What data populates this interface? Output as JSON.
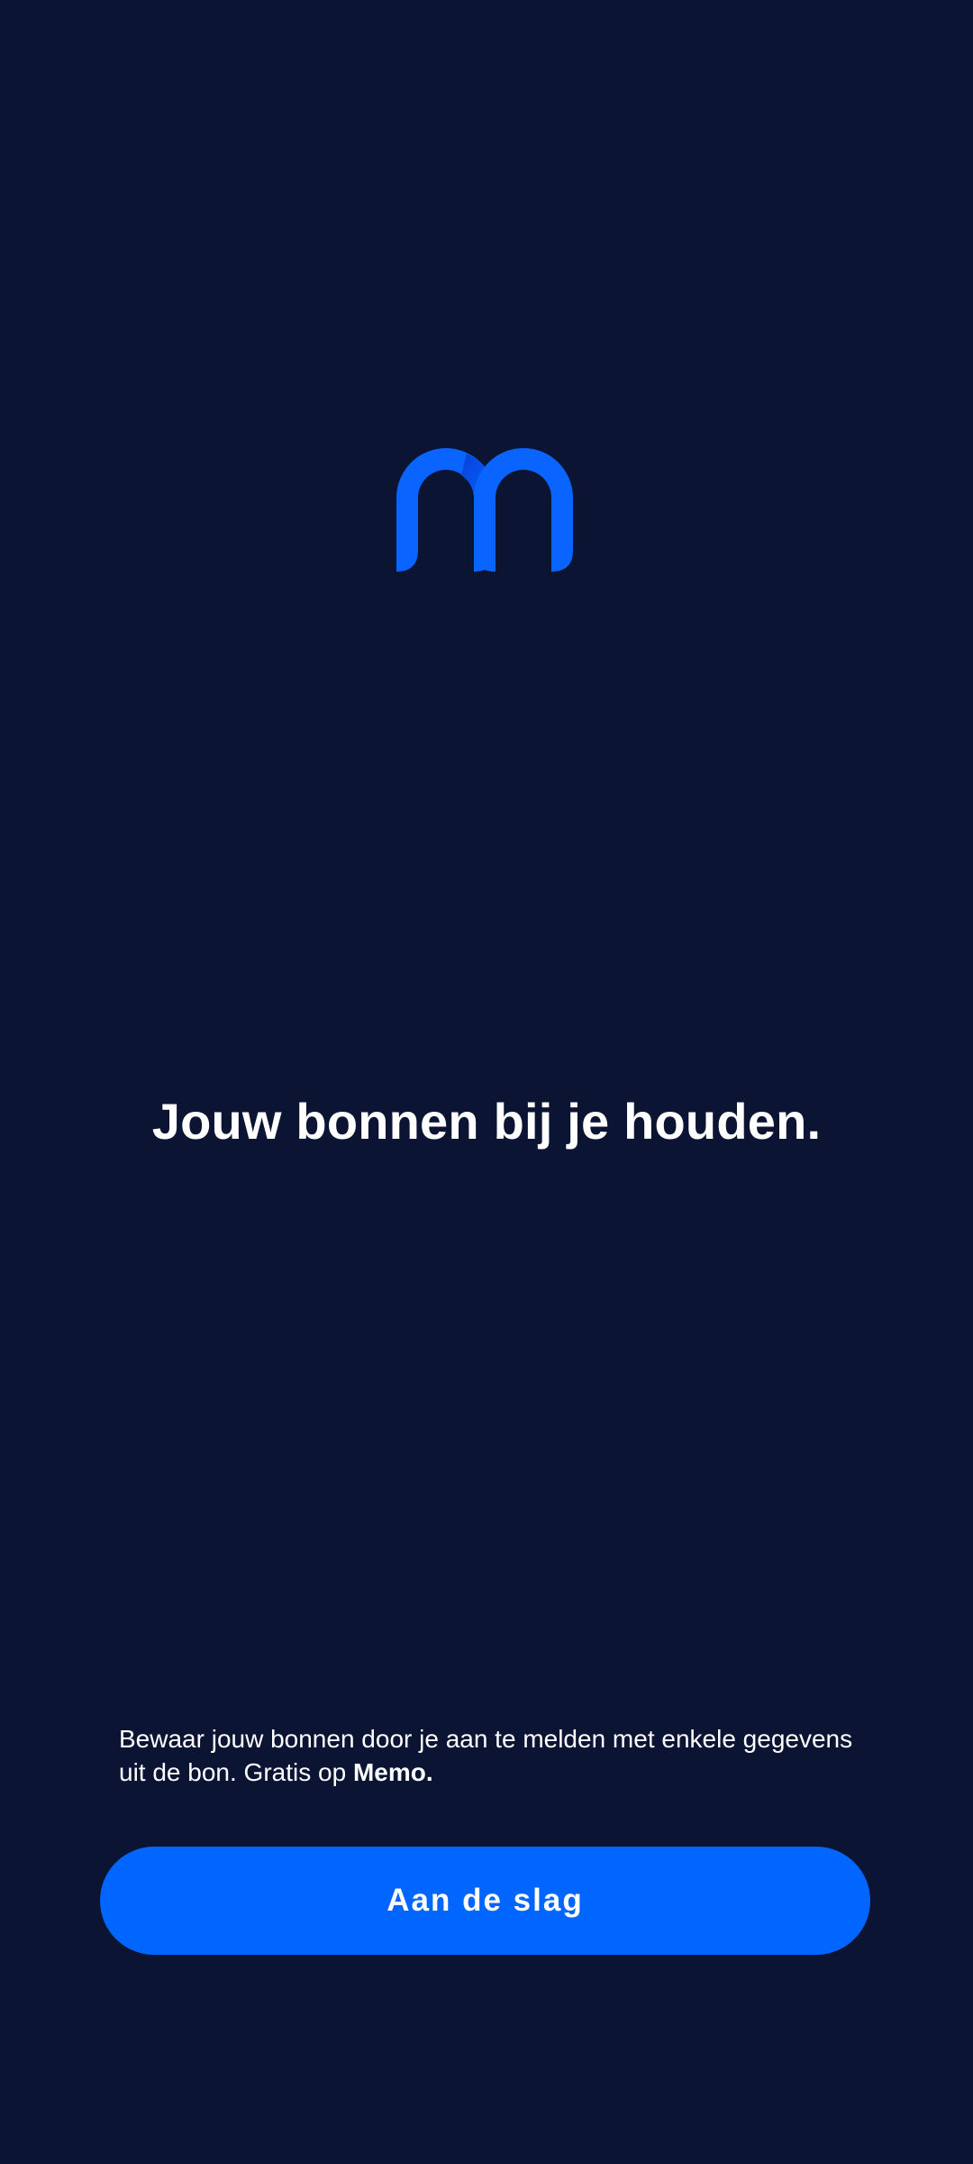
{
  "brand": {
    "logo_icon": "memo-m-logo-icon",
    "accent_color": "#0066FF",
    "background_color": "#0B1533",
    "text_color": "#FFFFFF"
  },
  "onboarding": {
    "headline": "Jouw bonnen bij je houden.",
    "description_text": "Bewaar jouw bonnen door je aan te melden met enkele gegevens uit de bon. Gratis op ",
    "description_brand": "Memo.",
    "cta_label": "Aan de slag"
  }
}
